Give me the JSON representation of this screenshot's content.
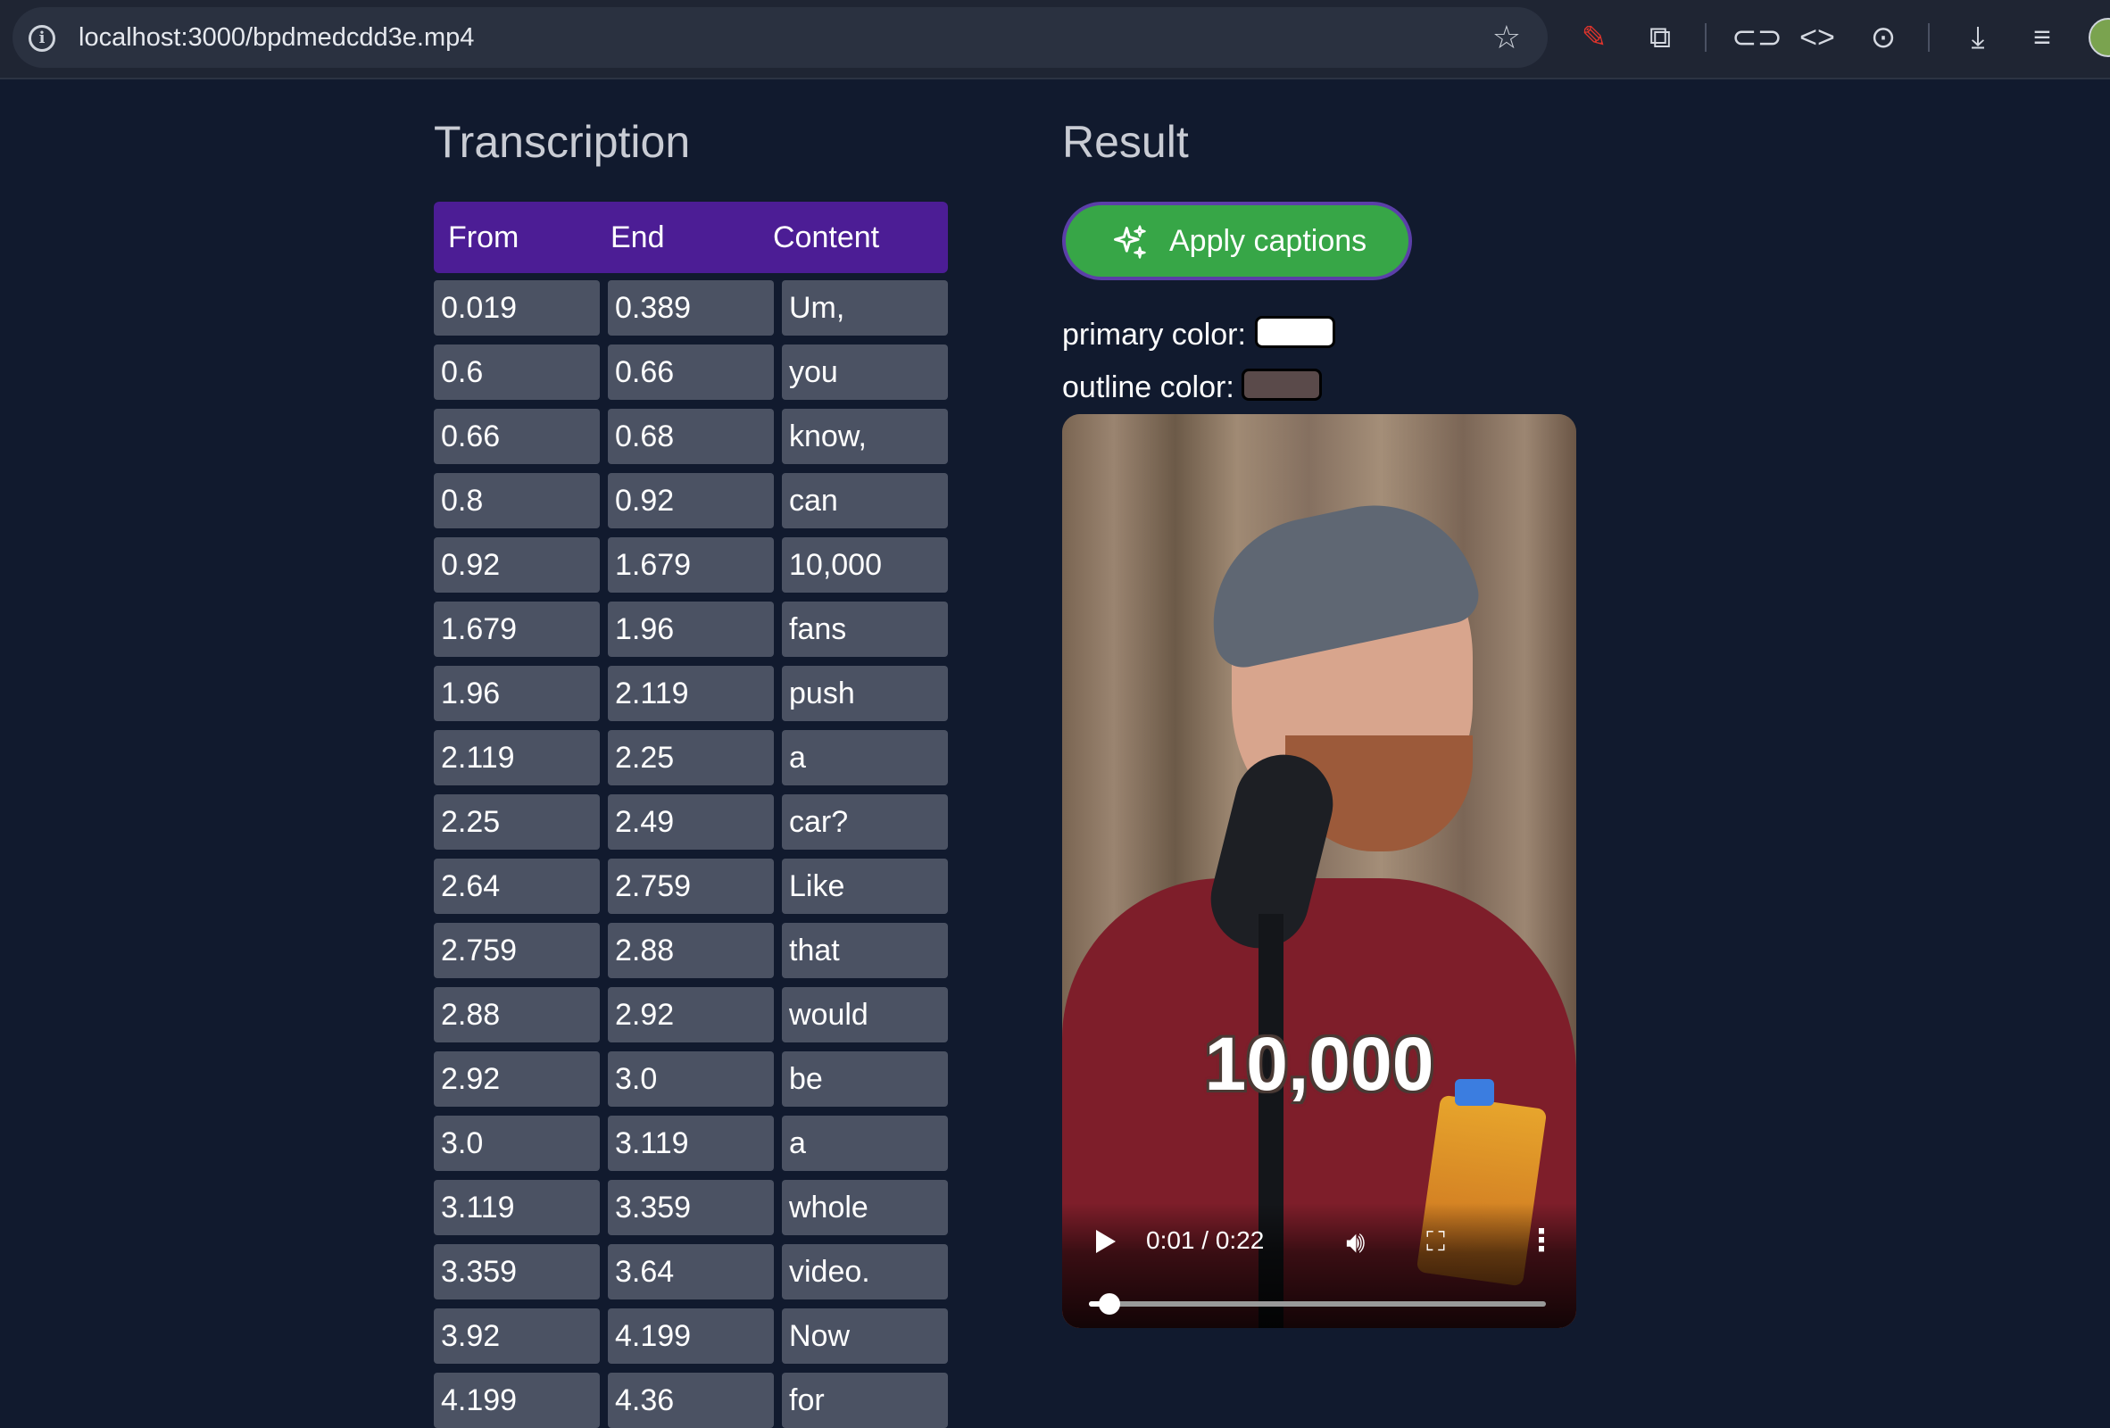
{
  "browser": {
    "url": "localhost:3000/bpdmedcdd3e.mp4",
    "icons": [
      "info-icon",
      "bookmark-star-icon",
      "pen-icon",
      "extension-icon",
      "link-icon",
      "code-icon",
      "capture-icon",
      "download-icon",
      "queue-icon"
    ]
  },
  "transcription": {
    "title": "Transcription",
    "columns": [
      "From",
      "End",
      "Content"
    ],
    "rows": [
      [
        "0.019",
        "0.389",
        "Um,"
      ],
      [
        "0.6",
        "0.66",
        "you"
      ],
      [
        "0.66",
        "0.68",
        "know,"
      ],
      [
        "0.8",
        "0.92",
        "can"
      ],
      [
        "0.92",
        "1.679",
        "10,000"
      ],
      [
        "1.679",
        "1.96",
        "fans"
      ],
      [
        "1.96",
        "2.119",
        "push"
      ],
      [
        "2.119",
        "2.25",
        "a"
      ],
      [
        "2.25",
        "2.49",
        "car?"
      ],
      [
        "2.64",
        "2.759",
        "Like"
      ],
      [
        "2.759",
        "2.88",
        "that"
      ],
      [
        "2.88",
        "2.92",
        "would"
      ],
      [
        "2.92",
        "3.0",
        "be"
      ],
      [
        "3.0",
        "3.119",
        "a"
      ],
      [
        "3.119",
        "3.359",
        "whole"
      ],
      [
        "3.359",
        "3.64",
        "video."
      ],
      [
        "3.92",
        "4.199",
        "Now"
      ],
      [
        "4.199",
        "4.36",
        "for"
      ]
    ]
  },
  "result": {
    "title": "Result",
    "apply_label": "Apply captions",
    "primary_color_label": "primary color:",
    "primary_color": "#ffffff",
    "outline_color_label": "outline color:",
    "outline_color": "#5a4a4a",
    "video": {
      "caption": "10,000",
      "time": "0:01 / 0:22",
      "progress": 0.0455
    }
  }
}
